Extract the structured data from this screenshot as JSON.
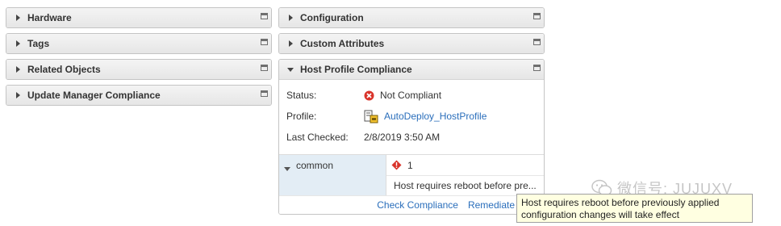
{
  "left_portlets": [
    {
      "title": "Hardware"
    },
    {
      "title": "Tags"
    },
    {
      "title": "Related Objects"
    },
    {
      "title": "Update Manager Compliance"
    }
  ],
  "right_portlets": [
    {
      "title": "Configuration"
    },
    {
      "title": "Custom Attributes"
    }
  ],
  "host_profile_compliance": {
    "title": "Host Profile Compliance",
    "status_label": "Status:",
    "status_value": "Not Compliant",
    "profile_label": "Profile:",
    "profile_value": "AutoDeploy_HostProfile",
    "last_checked_label": "Last Checked:",
    "last_checked_value": "2/8/2019 3:50 AM",
    "group_name": "common",
    "issue_count": "1",
    "issue_text": "Host requires reboot before pre...",
    "check_compliance_label": "Check Compliance",
    "remediate_label": "Remediate"
  },
  "tooltip": {
    "text": "Host requires reboot before previously applied\nconfiguration changes will take effect"
  },
  "watermark": {
    "text": "微信号: JUJUXV"
  },
  "colors": {
    "link": "#2a6ebb",
    "error_red": "#d9342b",
    "key_column_bg": "#e3edf5",
    "tooltip_bg": "#ffffe1"
  },
  "icons": {
    "collapsed_chevron": "chevron-right-icon",
    "expanded_chevron": "chevron-down-icon",
    "maximize": "maximize-icon",
    "status": "error-circle-icon",
    "profile": "host-profile-icon",
    "issue": "warning-diamond-icon"
  }
}
